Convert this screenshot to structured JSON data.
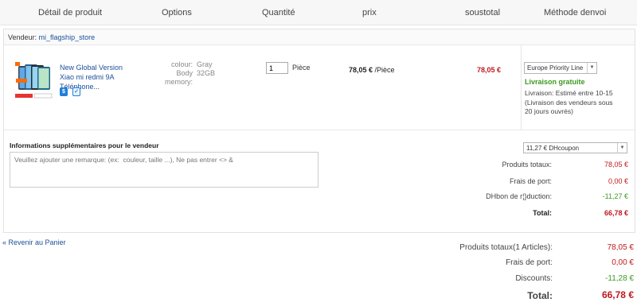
{
  "header": {
    "product": "Détail de produit",
    "options": "Options",
    "quantity": "Quantité",
    "price": "prix",
    "subtotal": "soustotal",
    "shipping": "Méthode denvoi"
  },
  "seller": {
    "label": "Vendeur:",
    "name": "mi_flagship_store"
  },
  "product": {
    "title": "New Global Version Xiao mi redmi 9A Téléphone...",
    "options": [
      {
        "label": "colour:",
        "value": "Gray"
      },
      {
        "label": "Body",
        "value": "32GB"
      },
      {
        "label": "memory:",
        "value": ""
      }
    ],
    "quantity": "1",
    "unit": "Pièce",
    "price": "78,05 €",
    "price_unit": " /Pièce",
    "subtotal": "78,05 €"
  },
  "shipping": {
    "method": "Europe Priority Line",
    "free": "Livraison gratuite",
    "delivery": "Livraison: Estimé entre 10-15 (Livraison des vendeurs sous 20 jours ouvrés)"
  },
  "seller_info": {
    "title": "Informations supplémentaires pour le vendeur",
    "placeholder": "Veuillez ajouter une remarque: (ex:  couleur, taille ...), Ne pas entrer <> &"
  },
  "coupon": {
    "value": "11,27 € DHcoupon"
  },
  "store_summary": {
    "total_products_label": "Produits totaux:",
    "total_products": "78,05 €",
    "shipping_label": "Frais de port:",
    "shipping": "0,00 €",
    "discount_label": "DHbon de r¦}duction:",
    "discount": "-11,27 €",
    "total_label": "Total:",
    "total": "66,78 €"
  },
  "back_link": "« Revenir au Panier",
  "order_summary": {
    "total_products_label": "Produits totaux(1 Articles):",
    "total_products": "78,05 €",
    "shipping_label": "Frais de port:",
    "shipping": "0,00 €",
    "discounts_label": "Discounts:",
    "discounts": "-11,28 €",
    "total_label": "Total:",
    "total": "66,78 €"
  },
  "colors": {
    "accent_red": "#c0181d",
    "accent_green": "#3b9a1e",
    "link_blue": "#1b4f9c"
  }
}
